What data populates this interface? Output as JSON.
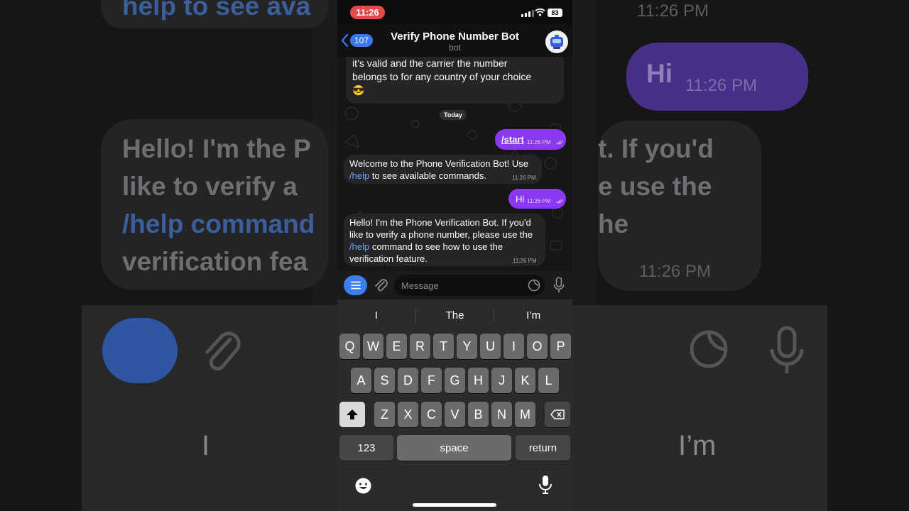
{
  "status_bar": {
    "time": "11:26",
    "battery": "83"
  },
  "header": {
    "back_count": "107",
    "title": "Verify Phone Number Bot",
    "subtitle": "bot"
  },
  "messages": [
    {
      "side": "in",
      "text_lines": [
        "it’s valid and the carrier the number",
        "belongs to for any country of your choice",
        "😎"
      ]
    },
    {
      "side": "out",
      "text": "/start",
      "time": "11:26 PM"
    },
    {
      "side": "in",
      "text_pre": "Welcome to the Phone Verification Bot! Use ",
      "link": "/help",
      "text_post": " to see available commands.",
      "time": "11:26 PM"
    },
    {
      "side": "out",
      "text": "Hi",
      "time": "11:26 PM"
    },
    {
      "side": "in",
      "text_pre": "Hello! I'm the Phone Verification Bot. If you'd like to verify a phone number, please use the ",
      "link": "/help",
      "text_post": " command to see how to use the verification feature.",
      "time": "11:26 PM"
    }
  ],
  "date_separator": "Today",
  "input": {
    "placeholder": "Message"
  },
  "keyboard": {
    "suggestions": [
      "I",
      "The",
      "I’m"
    ],
    "row1": [
      "Q",
      "W",
      "E",
      "R",
      "T",
      "Y",
      "U",
      "I",
      "O",
      "P"
    ],
    "row2": [
      "A",
      "S",
      "D",
      "F",
      "G",
      "H",
      "J",
      "K",
      "L"
    ],
    "row3": [
      "Z",
      "X",
      "C",
      "V",
      "B",
      "N",
      "M"
    ],
    "numbers": "123",
    "space": "space",
    "return": "return"
  },
  "backdrop": {
    "left_lines": [
      "Hello! I'm the P",
      "like to verify a",
      "/help command",
      "verification fea"
    ],
    "right_lines": [
      "t. If you'd",
      "e use the",
      "he"
    ],
    "top_fragment": "help to see ava",
    "hi": "Hi",
    "time": "11:26 PM",
    "suggestion_left": "I",
    "suggestion_right": "I’m"
  }
}
